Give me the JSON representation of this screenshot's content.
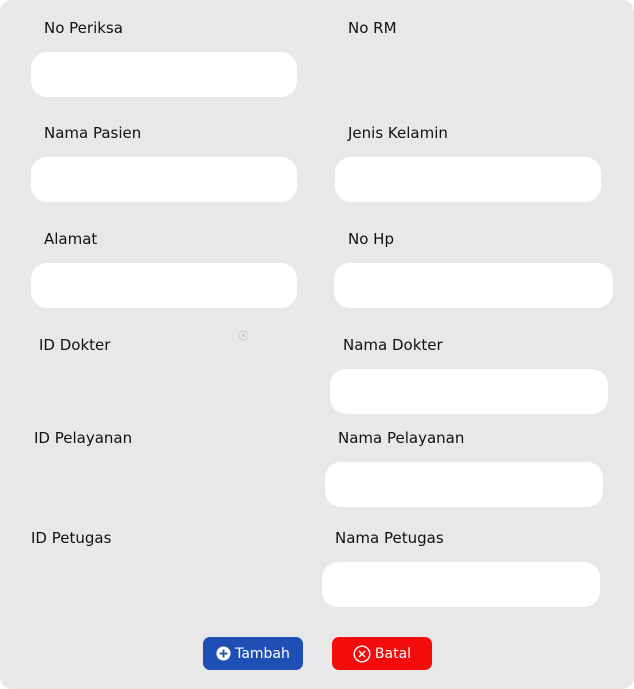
{
  "form": {
    "no_periksa": {
      "label": "No Periksa",
      "value": ""
    },
    "no_rm": {
      "label": "No RM"
    },
    "nama_pasien": {
      "label": "Nama Pasien",
      "value": ""
    },
    "jenis_kelamin": {
      "label": "Jenis Kelamin",
      "value": ""
    },
    "alamat": {
      "label": "Alamat",
      "value": ""
    },
    "no_hp": {
      "label": "No Hp",
      "value": ""
    },
    "id_dokter": {
      "label": "ID Dokter"
    },
    "nama_dokter": {
      "label": "Nama Dokter",
      "value": ""
    },
    "id_pelayanan": {
      "label": "ID Pelayanan"
    },
    "nama_pelayanan": {
      "label": "Nama Pelayanan",
      "value": ""
    },
    "id_petugas": {
      "label": "ID Petugas"
    },
    "nama_petugas": {
      "label": "Nama Petugas",
      "value": ""
    }
  },
  "actions": {
    "add_label": "Tambah",
    "add_icon": "plus-circle-icon",
    "add_color": "#1f4fb5",
    "cancel_label": "Batal",
    "cancel_icon": "x-circle-icon",
    "cancel_color": "#f20c0c"
  },
  "theme": {
    "panel_bg": "#e8e8e8",
    "input_bg": "#ffffff"
  }
}
